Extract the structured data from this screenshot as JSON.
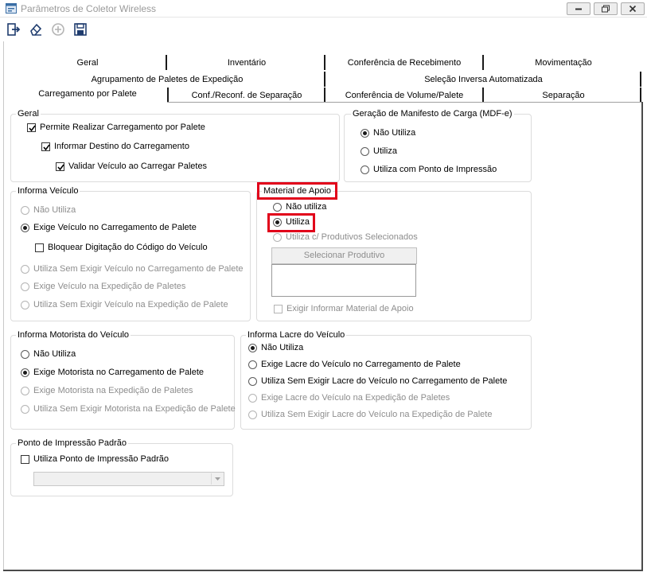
{
  "window": {
    "title": "Parâmetros de Coletor Wireless",
    "icon": "app-window-icon"
  },
  "toolbar": {
    "buttons": [
      {
        "name": "exit-icon"
      },
      {
        "name": "eraser-icon"
      },
      {
        "name": "add-circle-icon",
        "disabled": true
      },
      {
        "name": "save-icon"
      }
    ]
  },
  "tabs": {
    "row1": [
      "Geral",
      "Inventário",
      "Conferência de Recebimento",
      "Movimentação"
    ],
    "row2": [
      "Agrupamento de Paletes de Expedição",
      "Seleção Inversa Automatizada"
    ],
    "row3": [
      "Carregamento por Palete",
      "Conf./Reconf. de Separação",
      "Conferência de Volume/Palete",
      "Separação"
    ],
    "active": "Carregamento por Palete"
  },
  "geral": {
    "title": "Geral",
    "permite": "Permite Realizar Carregamento por Palete",
    "informar_destino": "Informar Destino do Carregamento",
    "validar_veiculo": "Validar Veículo ao Carregar Paletes"
  },
  "mdfe": {
    "title": "Geração de Manifesto de Carga (MDF-e)",
    "options": [
      "Não Utiliza",
      "Utiliza",
      "Utiliza com Ponto de Impressão"
    ],
    "selected": "Não Utiliza"
  },
  "informa_veiculo": {
    "title": "Informa Veículo",
    "nao_utiliza": "Não Utiliza",
    "exige_carregamento": "Exige Veículo no Carregamento de Palete",
    "bloquear": "Bloquear Digitação do Código do Veículo",
    "sem_exigir_carregamento": "Utiliza Sem Exigir Veículo no Carregamento de Palete",
    "exige_expedicao": "Exige Veículo na Expedição de Paletes",
    "sem_exigir_expedicao": "Utiliza Sem Exigir Veículo na Expedição de Palete",
    "selected": "Exige Veículo no Carregamento de Palete"
  },
  "material_apoio": {
    "title": "Material de Apoio",
    "nao_utiliza": "Não utiliza",
    "utiliza": "Utiliza",
    "produtivos": "Utiliza c/ Produtivos Selecionados",
    "selecionar_button": "Selecionar Produtivo",
    "exigir": "Exigir Informar Material de Apoio",
    "selected": "Utiliza",
    "highlight_color": "#e1001a"
  },
  "motorista": {
    "title": "Informa Motorista do Veículo",
    "options": [
      {
        "label": "Não Utiliza",
        "enabled": true
      },
      {
        "label": "Exige Motorista no Carregamento de Palete",
        "enabled": true
      },
      {
        "label": "Exige Motorista na Expedição de Paletes",
        "enabled": false
      },
      {
        "label": "Utiliza Sem Exigir Motorista na Expedição de Palete",
        "enabled": false
      }
    ],
    "selected": "Exige Motorista no Carregamento de Palete"
  },
  "lacre": {
    "title": "Informa Lacre do Veículo",
    "options": [
      {
        "label": "Não Utiliza",
        "enabled": true
      },
      {
        "label": "Exige Lacre do Veículo no Carregamento de Palete",
        "enabled": true
      },
      {
        "label": "Utiliza Sem Exigir Lacre do Veículo no Carregamento de Palete",
        "enabled": true
      },
      {
        "label": "Exige Lacre do Veículo na Expedição de Paletes",
        "enabled": false
      },
      {
        "label": "Utiliza Sem Exigir Lacre do Veículo na Expedição de Palete",
        "enabled": false
      }
    ],
    "selected": "Não Utiliza"
  },
  "ponto_impressao": {
    "title": "Ponto de Impressão Padrão",
    "utiliza": "Utiliza Ponto de Impressão Padrão",
    "combo_value": ""
  }
}
